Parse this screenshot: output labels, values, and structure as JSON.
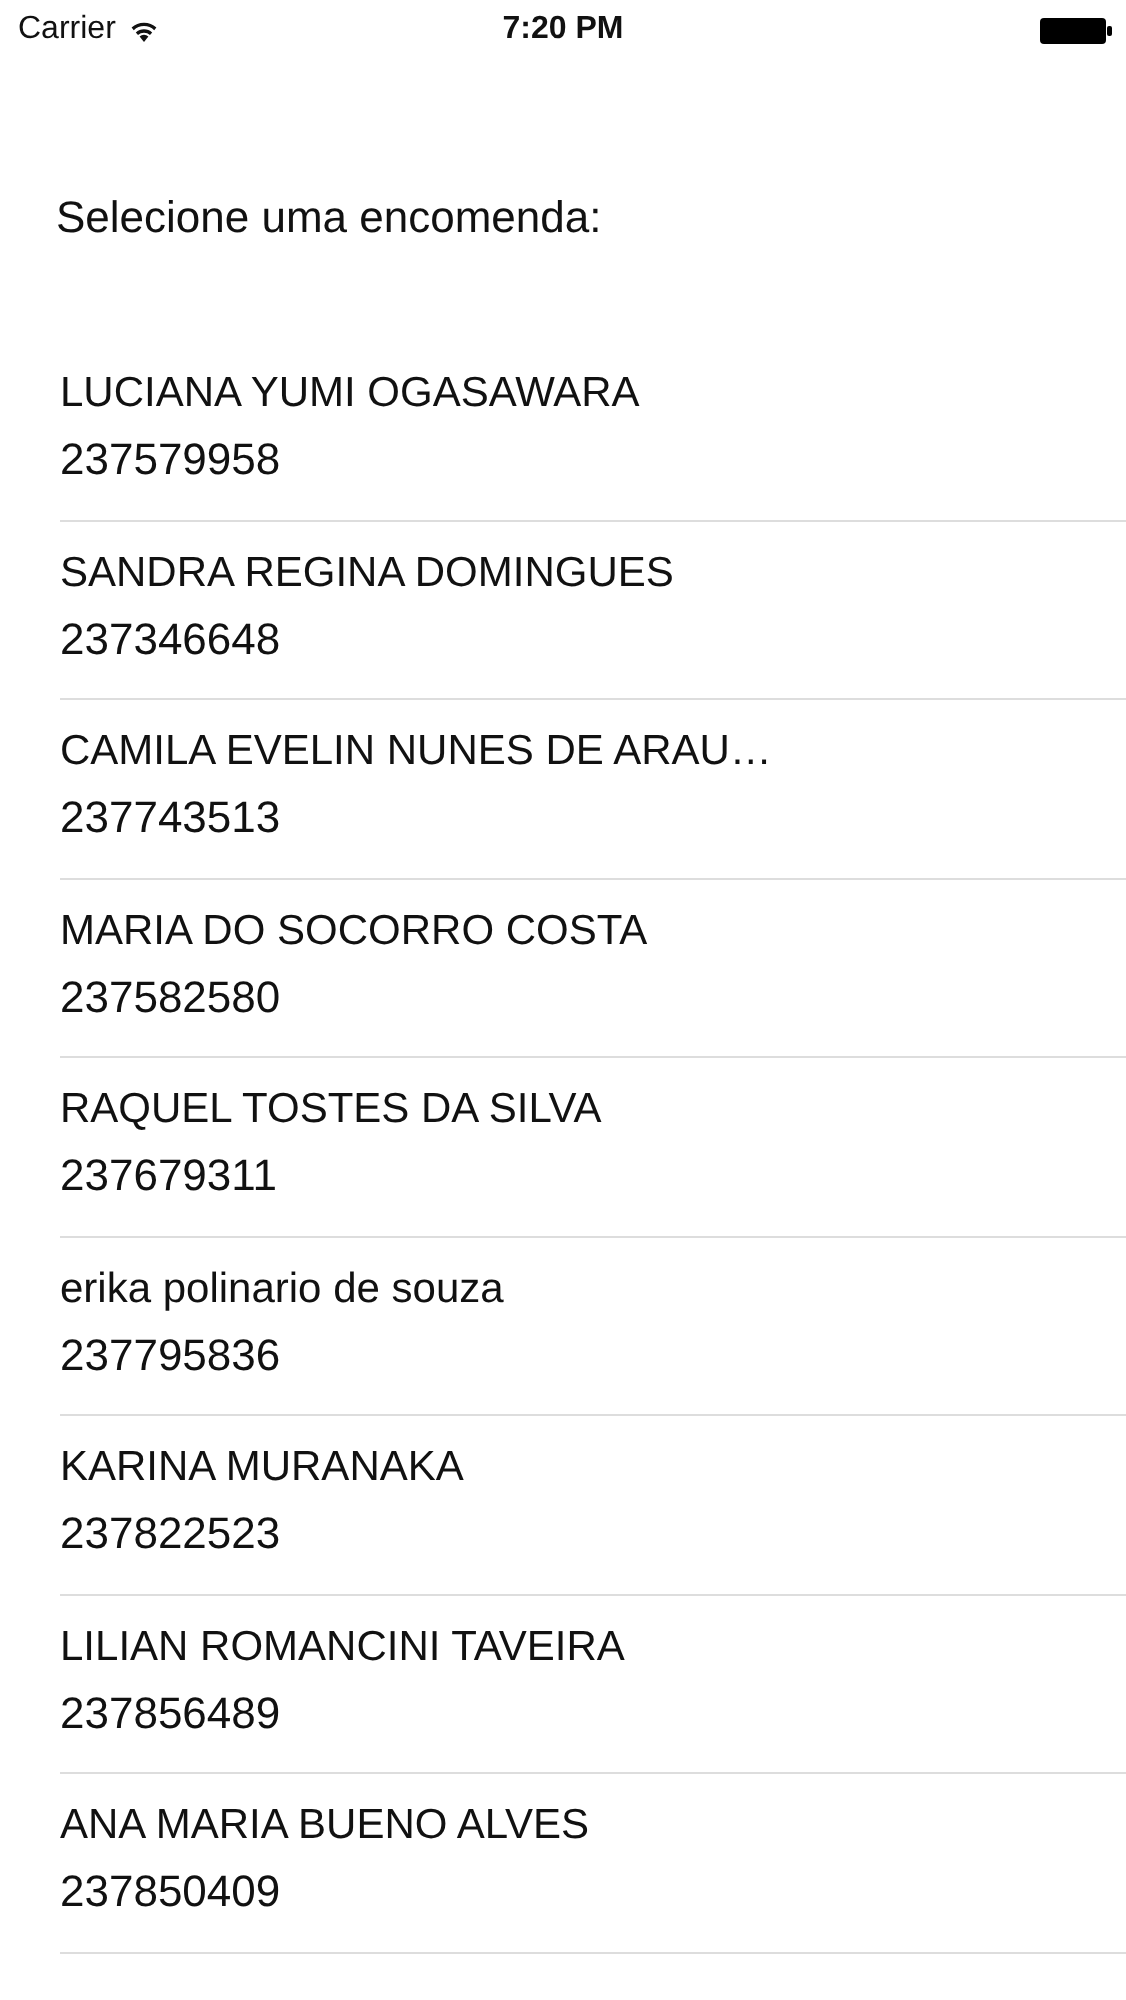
{
  "status_bar": {
    "carrier": "Carrier",
    "time": "7:20 PM"
  },
  "heading": "Selecione uma encomenda:",
  "orders": [
    {
      "name": "LUCIANA YUMI OGASAWARA",
      "number": "237579958"
    },
    {
      "name": "SANDRA REGINA DOMINGUES",
      "number": "237346648"
    },
    {
      "name": "CAMILA EVELIN NUNES DE ARAU…",
      "number": "237743513"
    },
    {
      "name": "MARIA DO SOCORRO COSTA",
      "number": "237582580"
    },
    {
      "name": "RAQUEL TOSTES DA SILVA",
      "number": "237679311"
    },
    {
      "name": "erika polinario de souza",
      "number": "237795836"
    },
    {
      "name": "KARINA MURANAKA",
      "number": "237822523"
    },
    {
      "name": "LILIAN ROMANCINI TAVEIRA",
      "number": "237856489"
    },
    {
      "name": "ANA MARIA BUENO ALVES",
      "number": "237850409"
    }
  ]
}
